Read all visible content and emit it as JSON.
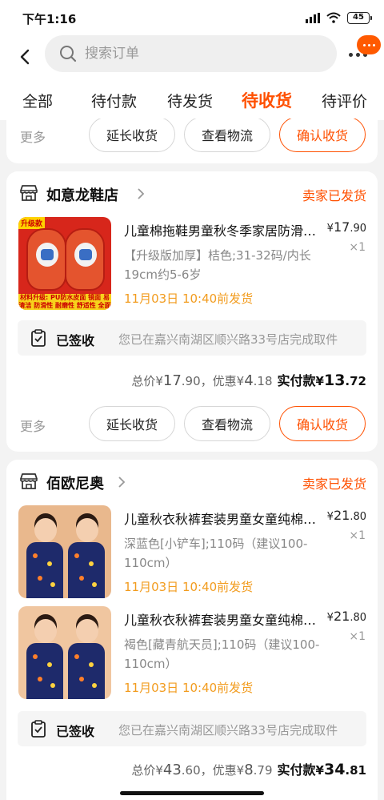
{
  "status_bar": {
    "time": "下午1:16",
    "battery": "45"
  },
  "header": {
    "search_placeholder": "搜索订单"
  },
  "tabs": [
    {
      "label": "全部",
      "active": false
    },
    {
      "label": "待付款",
      "active": false
    },
    {
      "label": "待发货",
      "active": false
    },
    {
      "label": "待收货",
      "active": true
    },
    {
      "label": "待评价",
      "active": false
    }
  ],
  "actions": {
    "more": "更多",
    "extend": "延长收货",
    "logistics": "查看物流",
    "confirm": "确认收货"
  },
  "orders": [
    {
      "shop": "如意龙鞋店",
      "status": "卖家已发货",
      "items": [
        {
          "title": "儿童棉拖鞋男童秋冬季家居防滑保暖",
          "price_symbol": "¥",
          "price_int": "17",
          "price_dec": ".90",
          "qty": "×1",
          "spec": "【升级版加厚】桔色;31-32码/内长19cm约5-6岁",
          "ship": "11月03日 10:40前发货",
          "thumb_tag": "升级款",
          "thumb_band": "材料升级: PU防水皮面 镜面 易清洁 防滑性 耐磨性 舒适性 全面提升"
        }
      ],
      "sign_label": "已签收",
      "sign_text": "您已在嘉兴南湖区顺兴路33号店完成取件",
      "total_label": "总价",
      "total_int": "17",
      "total_dec": ".90",
      "discount_label": "，优惠",
      "discount_int": "4",
      "discount_dec": ".18",
      "pay_label": "实付款",
      "pay_int": "13",
      "pay_dec": ".72"
    },
    {
      "shop": "佰欧尼奥",
      "status": "卖家已发货",
      "items": [
        {
          "title": "儿童秋衣秋裤套装男童女童纯棉睡衣",
          "price_symbol": "¥",
          "price_int": "21",
          "price_dec": ".80",
          "qty": "×1",
          "spec": "深蓝色[小铲车];110码（建议100-110cm）",
          "ship": "11月03日 10:40前发货"
        },
        {
          "title": "儿童秋衣秋裤套装男童女童纯棉睡衣",
          "price_symbol": "¥",
          "price_int": "21",
          "price_dec": ".80",
          "qty": "×1",
          "spec": "褐色[藏青航天员];110码（建议100-110cm）",
          "ship": "11月03日 10:40前发货"
        }
      ],
      "sign_label": "已签收",
      "sign_text": "您已在嘉兴南湖区顺兴路33号店完成取件",
      "total_label": "总价",
      "total_int": "43",
      "total_dec": ".60",
      "discount_label": "，优惠",
      "discount_int": "8",
      "discount_dec": ".79",
      "pay_label": "实付款",
      "pay_int": "34",
      "pay_dec": ".81"
    }
  ],
  "colors": {
    "accent": "#ff5000",
    "ship": "#f29c1f",
    "muted": "#999999"
  },
  "icons": [
    "back-arrow-icon",
    "search-icon",
    "more-dots-icon",
    "message-icon",
    "shop-icon",
    "chevron-right-icon",
    "clipboard-check-icon"
  ]
}
